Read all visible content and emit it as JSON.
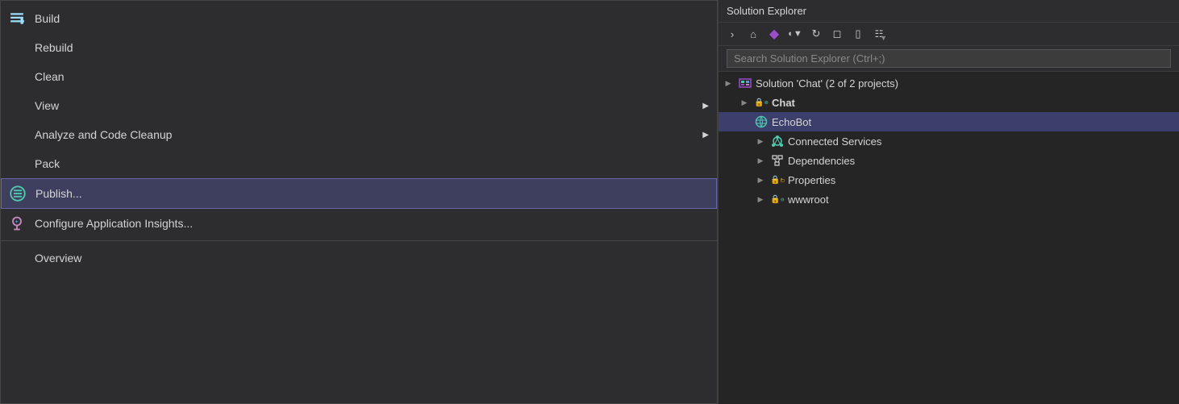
{
  "contextMenu": {
    "items": [
      {
        "id": "build",
        "label": "Build",
        "hasIcon": true,
        "iconType": "build",
        "hasSubmenu": false
      },
      {
        "id": "rebuild",
        "label": "Rebuild",
        "hasIcon": false,
        "hasSubmenu": false
      },
      {
        "id": "clean",
        "label": "Clean",
        "hasIcon": false,
        "hasSubmenu": false
      },
      {
        "id": "view",
        "label": "View",
        "hasIcon": false,
        "hasSubmenu": true
      },
      {
        "id": "analyze",
        "label": "Analyze and Code Cleanup",
        "hasIcon": false,
        "hasSubmenu": true
      },
      {
        "id": "pack",
        "label": "Pack",
        "hasIcon": false,
        "hasSubmenu": false
      },
      {
        "id": "publish",
        "label": "Publish...",
        "hasIcon": true,
        "iconType": "publish",
        "highlighted": true,
        "hasSubmenu": false
      },
      {
        "id": "insights",
        "label": "Configure Application Insights...",
        "hasIcon": true,
        "iconType": "insights",
        "hasSubmenu": false
      },
      {
        "id": "separator",
        "type": "separator"
      },
      {
        "id": "overview",
        "label": "Overview",
        "hasIcon": false,
        "hasSubmenu": false
      }
    ]
  },
  "solutionExplorer": {
    "title": "Solution Explorer",
    "searchPlaceholder": "Search Solution Explorer (Ctrl+;)",
    "tree": [
      {
        "id": "solution",
        "label": "Solution 'Chat' (2 of 2 projects)",
        "level": 0,
        "expanded": true,
        "hasExpander": true,
        "iconType": "vs",
        "bold": false
      },
      {
        "id": "chat",
        "label": "Chat",
        "level": 1,
        "expanded": true,
        "hasExpander": true,
        "iconType": "globe-lock",
        "bold": true
      },
      {
        "id": "echobot",
        "label": "EchoBot",
        "level": 1,
        "expanded": true,
        "hasExpander": false,
        "iconType": "globe",
        "bold": false,
        "selected": true
      },
      {
        "id": "connected-services",
        "label": "Connected Services",
        "level": 2,
        "expanded": false,
        "hasExpander": true,
        "iconType": "connected",
        "bold": false
      },
      {
        "id": "dependencies",
        "label": "Dependencies",
        "level": 2,
        "expanded": false,
        "hasExpander": true,
        "iconType": "deps",
        "bold": false
      },
      {
        "id": "properties",
        "label": "Properties",
        "level": 2,
        "expanded": false,
        "hasExpander": true,
        "iconType": "folder-lock",
        "bold": false
      },
      {
        "id": "wwwroot",
        "label": "wwwroot",
        "level": 2,
        "expanded": false,
        "hasExpander": true,
        "iconType": "globe-lock2",
        "bold": false
      }
    ],
    "toolbar": {
      "buttons": [
        "back",
        "home",
        "vs-logo",
        "history",
        "refresh",
        "collapse",
        "sync",
        "filter"
      ]
    }
  }
}
